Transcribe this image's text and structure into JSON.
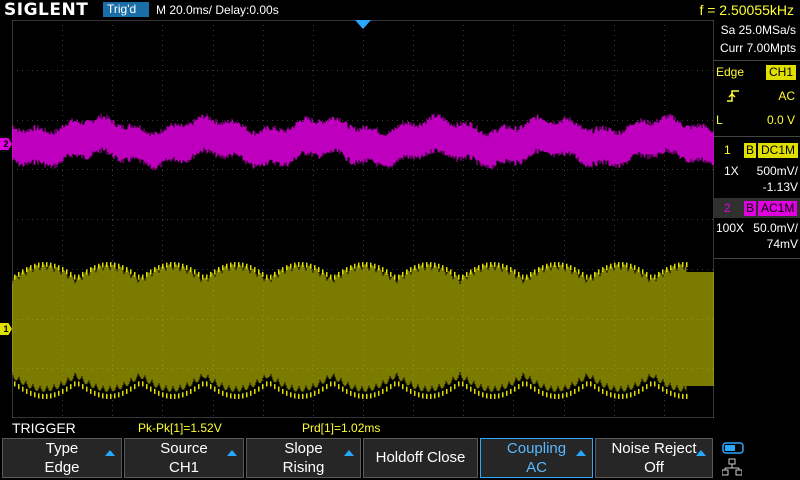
{
  "header": {
    "brand": "SIGLENT",
    "trigger_status": "Trig'd",
    "timebase": "M 20.0ms/ Delay:0.00s",
    "frequency": "f = 2.50055kHz"
  },
  "acquisition": {
    "sample_rate": "Sa 25.0MSa/s",
    "memory_depth": "Curr 7.00Mpts"
  },
  "trigger_info": {
    "type_label": "Edge",
    "source": "CH1",
    "slope_icon": "rising-edge-icon",
    "coupling": "AC",
    "level_label": "L",
    "level_value": "0.0 V"
  },
  "channels": [
    {
      "number": "1",
      "bw": "B",
      "coupling": "DC1M",
      "probe": "1X",
      "scale": "500mV/",
      "offset": "-1.13V",
      "color": "#e0e000"
    },
    {
      "number": "2",
      "bw": "B",
      "coupling": "AC1M",
      "probe": "100X",
      "scale": "50.0mV/",
      "offset": "74mV",
      "color": "#e000e0"
    }
  ],
  "markers": {
    "ch1": "1",
    "ch2": "2"
  },
  "menu_title": "TRIGGER",
  "measurements": [
    {
      "text": "Pk-Pk[1]=1.52V"
    },
    {
      "text": "Prd[1]=1.02ms"
    }
  ],
  "softkeys": [
    {
      "line1": "Type",
      "line2": "Edge",
      "arrow": true
    },
    {
      "line1": "Source",
      "line2": "CH1",
      "arrow": true
    },
    {
      "line1": "Slope",
      "line2": "Rising",
      "arrow": true
    },
    {
      "line1": "Holdoff Close",
      "line2": "",
      "arrow": false
    },
    {
      "line1": "Coupling",
      "line2": "AC",
      "arrow": true,
      "selected": true
    },
    {
      "line1": "Noise Reject",
      "line2": "Off",
      "arrow": true
    }
  ],
  "status_icons": [
    "toggle-icon",
    "network-icon"
  ],
  "colors": {
    "accent": "#2aa8ff",
    "ch1": "#e0e000",
    "ch2": "#e000e0",
    "freq": "#ffff33"
  }
}
